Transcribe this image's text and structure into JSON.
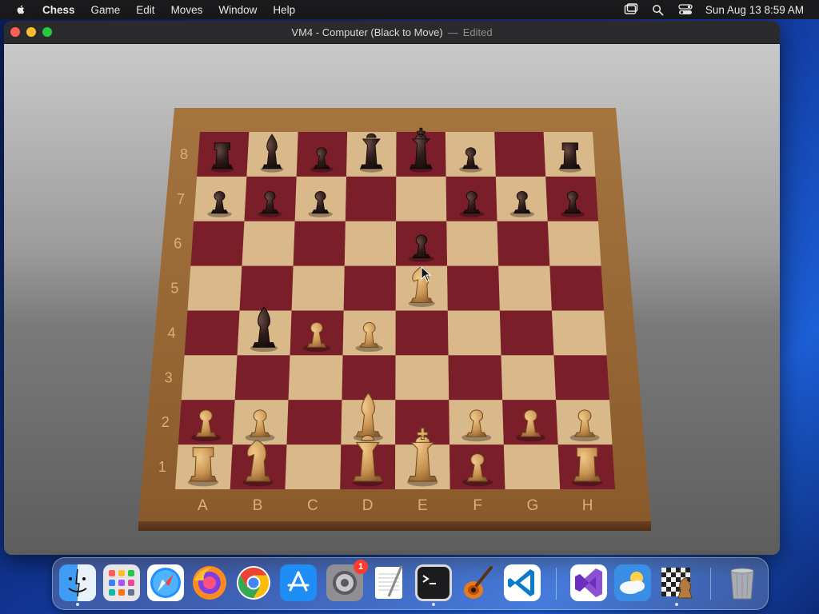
{
  "menubar": {
    "app_name": "Chess",
    "items": [
      "Game",
      "Edit",
      "Moves",
      "Window",
      "Help"
    ],
    "clock": "Sun Aug 13  8:59 AM"
  },
  "window": {
    "title_main": "VM4 - Computer  (Black to Move)",
    "title_separator": "—",
    "title_status": "Edited"
  },
  "board": {
    "files": [
      "A",
      "B",
      "C",
      "D",
      "E",
      "F",
      "G",
      "H"
    ],
    "ranks": [
      "1",
      "2",
      "3",
      "4",
      "5",
      "6",
      "7",
      "8"
    ],
    "colors": {
      "light_square": "#d9b98a",
      "dark_square": "#7a1f2a",
      "frame": "#9c6a3a",
      "white_piece": "#d2a15f",
      "black_piece": "#2a1a18"
    },
    "pieces": [
      {
        "square": "a8",
        "type": "rook",
        "color": "black"
      },
      {
        "square": "b8",
        "type": "bishop",
        "color": "black"
      },
      {
        "square": "c8",
        "type": "pawn",
        "color": "black"
      },
      {
        "square": "d8",
        "type": "queen",
        "color": "black"
      },
      {
        "square": "e8",
        "type": "king",
        "color": "black"
      },
      {
        "square": "f8",
        "type": "pawn",
        "color": "black"
      },
      {
        "square": "h8",
        "type": "rook",
        "color": "black"
      },
      {
        "square": "a7",
        "type": "pawn",
        "color": "black"
      },
      {
        "square": "b7",
        "type": "pawn",
        "color": "black"
      },
      {
        "square": "c7",
        "type": "pawn",
        "color": "black"
      },
      {
        "square": "f7",
        "type": "pawn",
        "color": "black"
      },
      {
        "square": "g7",
        "type": "pawn",
        "color": "black"
      },
      {
        "square": "h7",
        "type": "pawn",
        "color": "black"
      },
      {
        "square": "e6",
        "type": "pawn",
        "color": "black"
      },
      {
        "square": "b4",
        "type": "bishop",
        "color": "black"
      },
      {
        "square": "e5",
        "type": "knight",
        "color": "white"
      },
      {
        "square": "c4",
        "type": "pawn",
        "color": "white"
      },
      {
        "square": "d4",
        "type": "pawn",
        "color": "white"
      },
      {
        "square": "a2",
        "type": "pawn",
        "color": "white"
      },
      {
        "square": "b2",
        "type": "pawn",
        "color": "white"
      },
      {
        "square": "d2",
        "type": "bishop",
        "color": "white"
      },
      {
        "square": "f2",
        "type": "pawn",
        "color": "white"
      },
      {
        "square": "g2",
        "type": "pawn",
        "color": "white"
      },
      {
        "square": "h2",
        "type": "pawn",
        "color": "white"
      },
      {
        "square": "a1",
        "type": "rook",
        "color": "white"
      },
      {
        "square": "b1",
        "type": "knight",
        "color": "white"
      },
      {
        "square": "d1",
        "type": "queen",
        "color": "white"
      },
      {
        "square": "e1",
        "type": "king",
        "color": "white"
      },
      {
        "square": "f1",
        "type": "pawn",
        "color": "white"
      },
      {
        "square": "h1",
        "type": "rook",
        "color": "white"
      }
    ]
  },
  "dock": {
    "apps": [
      {
        "name": "finder"
      },
      {
        "name": "launchpad"
      },
      {
        "name": "safari"
      },
      {
        "name": "firefox"
      },
      {
        "name": "chrome"
      },
      {
        "name": "app-store"
      },
      {
        "name": "system-settings",
        "badge": "1"
      },
      {
        "name": "textedit"
      },
      {
        "name": "terminal"
      },
      {
        "name": "garageband"
      },
      {
        "name": "vscode"
      },
      {
        "name": "visual-studio"
      },
      {
        "name": "weather"
      },
      {
        "name": "chess"
      },
      {
        "name": "trash"
      }
    ]
  }
}
